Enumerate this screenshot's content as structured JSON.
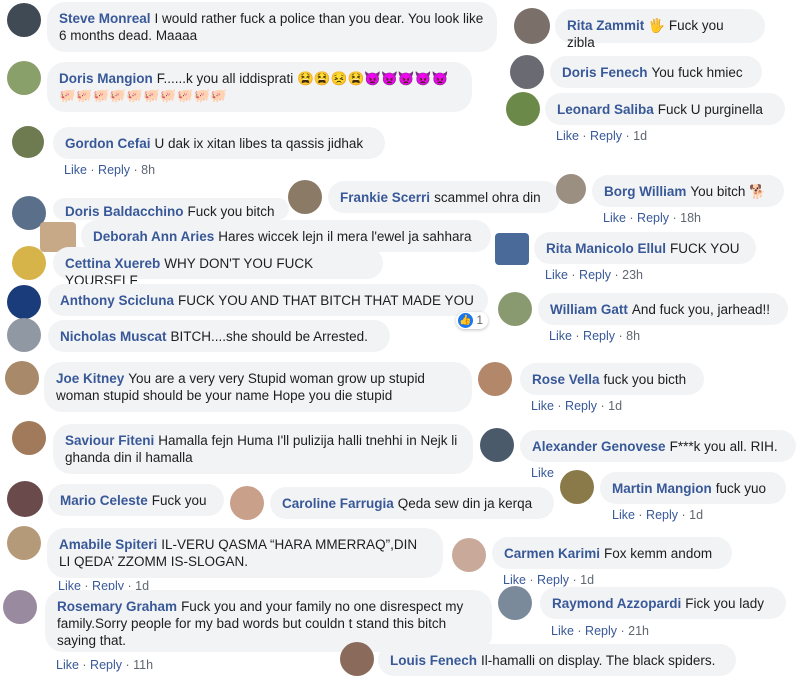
{
  "comments": [
    {
      "name": "Steve Monreal",
      "text": "I would rather fuck a police than you dear. You look like 6 months dead. Maaaa",
      "avatar_color": "#3f4a55"
    },
    {
      "name": "Rita Zammit",
      "text": "🖐 Fuck you zibla",
      "avatar_color": "#7b6f69"
    },
    {
      "name": "Doris Mangion",
      "text": "F......k you all iddisprati 😫😫😣😫👿👿👿👿👿 🐖🐖🐖🐖🐖🐖🐖🐖🐖🐖",
      "avatar_color": "#8aa06a"
    },
    {
      "name": "Doris Fenech",
      "text": "You fuck hmiec",
      "avatar_color": "#6a6a72"
    },
    {
      "name": "Leonard Saliba",
      "text": "Fuck U purginella",
      "avatar_color": "#6b8a4a",
      "actions": {
        "like": "Like",
        "reply": "Reply",
        "time": "1d"
      }
    },
    {
      "name": "Gordon Cefai",
      "text": "U dak ix xitan libes ta qassis jidhak",
      "avatar_color": "#6e7a50",
      "actions": {
        "like": "Like",
        "reply": "Reply",
        "time": "8h"
      }
    },
    {
      "name": "Frankie Scerri",
      "text": "scammel ohra din",
      "avatar_color": "#8b7a66"
    },
    {
      "name": "Borg William",
      "text": "You bitch 🐕",
      "avatar_color": "#9a8f80",
      "actions": {
        "like": "Like",
        "reply": "Reply",
        "time": "18h"
      }
    },
    {
      "name": "Doris Baldacchino",
      "text": "Fuck you bitch",
      "avatar_color": "#5a6f8a"
    },
    {
      "name": "Deborah Ann Aries",
      "text": "Hares wiccek lejn il mera l'ewel ja sahhara",
      "avatar_color": "#c7a988"
    },
    {
      "name": "Rita Manicolo Ellul",
      "text": "FUCK YOU",
      "avatar_color": "#4a6a9a",
      "actions": {
        "like": "Like",
        "reply": "Reply",
        "time": "23h"
      }
    },
    {
      "name": "Cettina Xuereb",
      "text": "WHY DON'T YOU FUCK YOURSELF",
      "avatar_color": "#d7b44a"
    },
    {
      "name": "Anthony Scicluna",
      "text": "FUCK YOU AND THAT BITCH THAT MADE YOU",
      "avatar_color": "#1b3c7a",
      "reaction_count": "1"
    },
    {
      "name": "William Gatt",
      "text": "And fuck you, jarhead!!",
      "avatar_color": "#8a9a70",
      "actions": {
        "like": "Like",
        "reply": "Reply",
        "time": "8h"
      }
    },
    {
      "name": "Nicholas Muscat",
      "text": "BITCH....she should be Arrested.",
      "avatar_color": "#8f98a3"
    },
    {
      "name": "Joe Kitney",
      "text": "You are a very very Stupid woman grow up stupid woman stupid should be your name Hope you die stupid",
      "avatar_color": "#a88a6a"
    },
    {
      "name": "Rose Vella",
      "text": "fuck you bicth",
      "avatar_color": "#b2876a",
      "actions": {
        "like": "Like",
        "reply": "Reply",
        "time": "1d"
      }
    },
    {
      "name": "Saviour Fiteni",
      "text": "Hamalla fejn Huma I'll pulizija halli tnehhi in Nejk li ghanda din il hamalla",
      "avatar_color": "#a07a5a"
    },
    {
      "name": "Alexander Genovese",
      "text": "F***k you all. RIH.",
      "avatar_color": "#4a5a6a",
      "actions": {
        "like": "Like"
      }
    },
    {
      "name": "Martin Mangion",
      "text": "fuck yuo",
      "avatar_color": "#8a7a4a",
      "actions": {
        "like": "Like",
        "reply": "Reply",
        "time": "1d"
      }
    },
    {
      "name": "Mario Celeste",
      "text": "Fuck you",
      "avatar_color": "#6a4a4a"
    },
    {
      "name": "Caroline Farrugia",
      "text": "Qeda sew din ja kerqa",
      "avatar_color": "#c9a08a"
    },
    {
      "name": "Amabile Spiteri",
      "text": "IL-VERU QASMA “HARA MMERRAQ”,DIN LI QEDA’ ZZOMM IS-SLOGAN.",
      "avatar_color": "#b59a7a",
      "actions": {
        "like": "Like",
        "reply": "Reply",
        "time": "1d"
      }
    },
    {
      "name": "Carmen Karimi",
      "text": "Fox kemm andom",
      "avatar_color": "#c9a99a",
      "actions": {
        "like": "Like",
        "reply": "Reply",
        "time": "1d"
      }
    },
    {
      "name": "Rosemary Graham",
      "text": "Fuck you and your family no one disrespect my family.Sorry people for my bad words but couldn t stand this bitch saying that.",
      "avatar_color": "#9a8aa0",
      "actions": {
        "like": "Like",
        "reply": "Reply",
        "time": "11h"
      }
    },
    {
      "name": "Raymond Azzopardi",
      "text": "Fick you lady",
      "avatar_color": "#7a8a9a",
      "actions": {
        "like": "Like",
        "reply": "Reply",
        "time": "21h"
      }
    },
    {
      "name": "Louis Fenech",
      "text": "Il-hamalli on display. The black spiders.",
      "avatar_color": "#8a6a5a"
    }
  ]
}
